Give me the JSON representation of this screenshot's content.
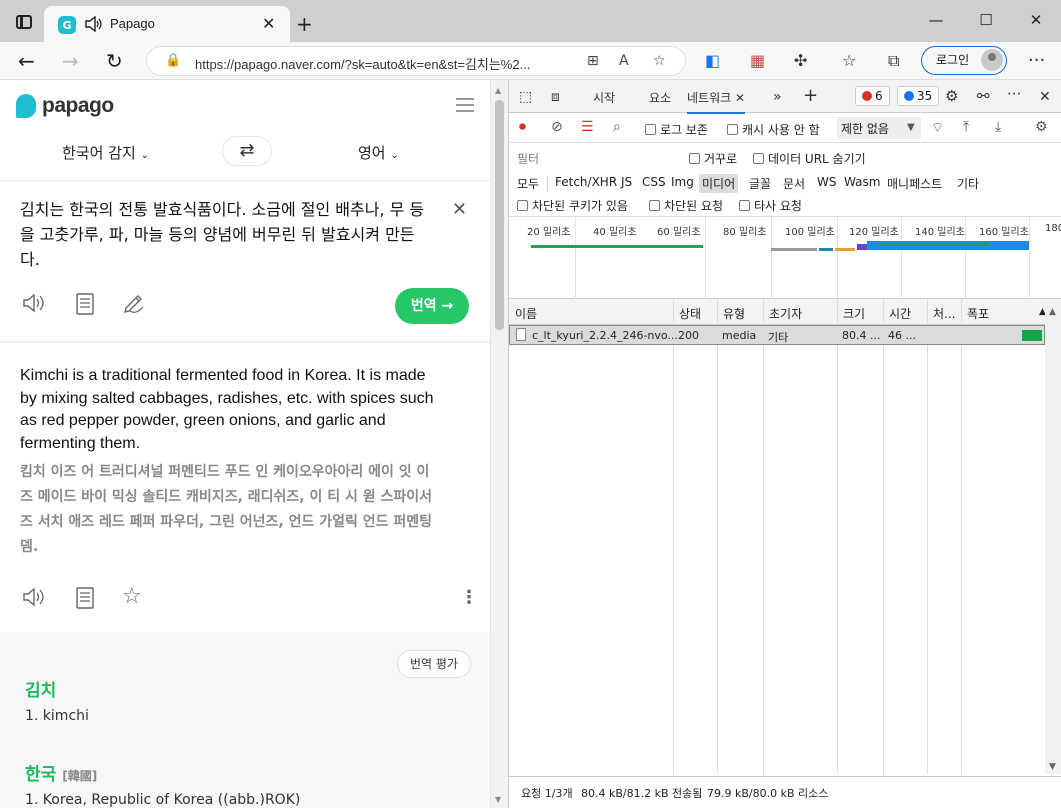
{
  "browser": {
    "tab_title": "Papago",
    "url": "https://papago.naver.com/?sk=auto&tk=en&st=김치는%2...",
    "login_label": "로그인"
  },
  "papago": {
    "logo_text": "papago",
    "source_lang": "한국어 감지",
    "target_lang": "영어",
    "source_text": "김치는 한국의 전통 발효식품이다. 소금에 절인 배추나, 무 등을 고춧가루, 파, 마늘 등의 양념에 버무린 뒤 발효시켜 만든다.",
    "translate_button": "번역",
    "translated_text": "Kimchi is a traditional fermented food in Korea. It is made by mixing salted cabbages, radishes, etc. with spices such as red pepper powder, green onions, and garlic and fermenting them.",
    "pronunciation": "킴치 이즈 어 트러디셔널 퍼멘티드 푸드 인 케이오우아아리 에이 잇 이즈 메이드 바이 믹싱 솔티드 캐비지즈, 래디쉬즈, 이 티 시 윋 스파이서즈 서치 애즈 레드 페퍼 파우더, 그린 어넌즈, 언드 가얼릭 언드 퍼멘팅 뎀.",
    "rate_button": "번역 평가",
    "dictionary": [
      {
        "word": "김치",
        "hanja": "",
        "defs": [
          "1. kimchi"
        ]
      },
      {
        "word": "한국",
        "hanja": "[韓國]",
        "defs": [
          "1. Korea, Republic of Korea ((abb.)ROK)"
        ]
      }
    ]
  },
  "devtools": {
    "tabs": [
      "시작",
      "요소",
      "네트워크"
    ],
    "active_tab": "네트워크",
    "error_count": "6",
    "message_count": "35",
    "preserve_log": "로그 보존",
    "disable_cache": "캐시 사용 안 함",
    "throttle": "제한 없음",
    "filter_label": "필터",
    "invert": "거꾸로",
    "hide_data_urls": "데이터 URL 숨기기",
    "types": [
      "모두",
      "Fetch/XHR",
      "JS",
      "CSS",
      "Img",
      "미디어",
      "글꼴",
      "문서",
      "WS",
      "Wasm",
      "매니페스트",
      "기타"
    ],
    "selected_type": "미디어",
    "options": [
      "차단된 쿠키가 있음",
      "차단된 요청",
      "타사 요청"
    ],
    "timeline_labels": [
      "20 밀리초",
      "40 밀리초",
      "60 밀리초",
      "80 밀리초",
      "100 밀리초",
      "120 밀리초",
      "140 밀리초",
      "160 밀리초",
      "180"
    ],
    "columns": [
      "이름",
      "상태",
      "유형",
      "초기자",
      "크기",
      "시간",
      "처...",
      "폭포"
    ],
    "rows": [
      {
        "name": "c_lt_kyuri_2.2.4_246-nvo...",
        "status": "200",
        "type": "media",
        "initiator": "기타",
        "size": "80.4 ...",
        "time": "46 ..."
      }
    ],
    "status": {
      "requests": "요청 1/3개",
      "transferred": "80.4 kB/81.2 kB 전송됨",
      "resources": "79.9 kB/80.0 kB 리소스"
    }
  },
  "colors": {
    "accent_green": "#25c767",
    "link_blue": "#1a73e8",
    "error_red": "#d93025"
  }
}
